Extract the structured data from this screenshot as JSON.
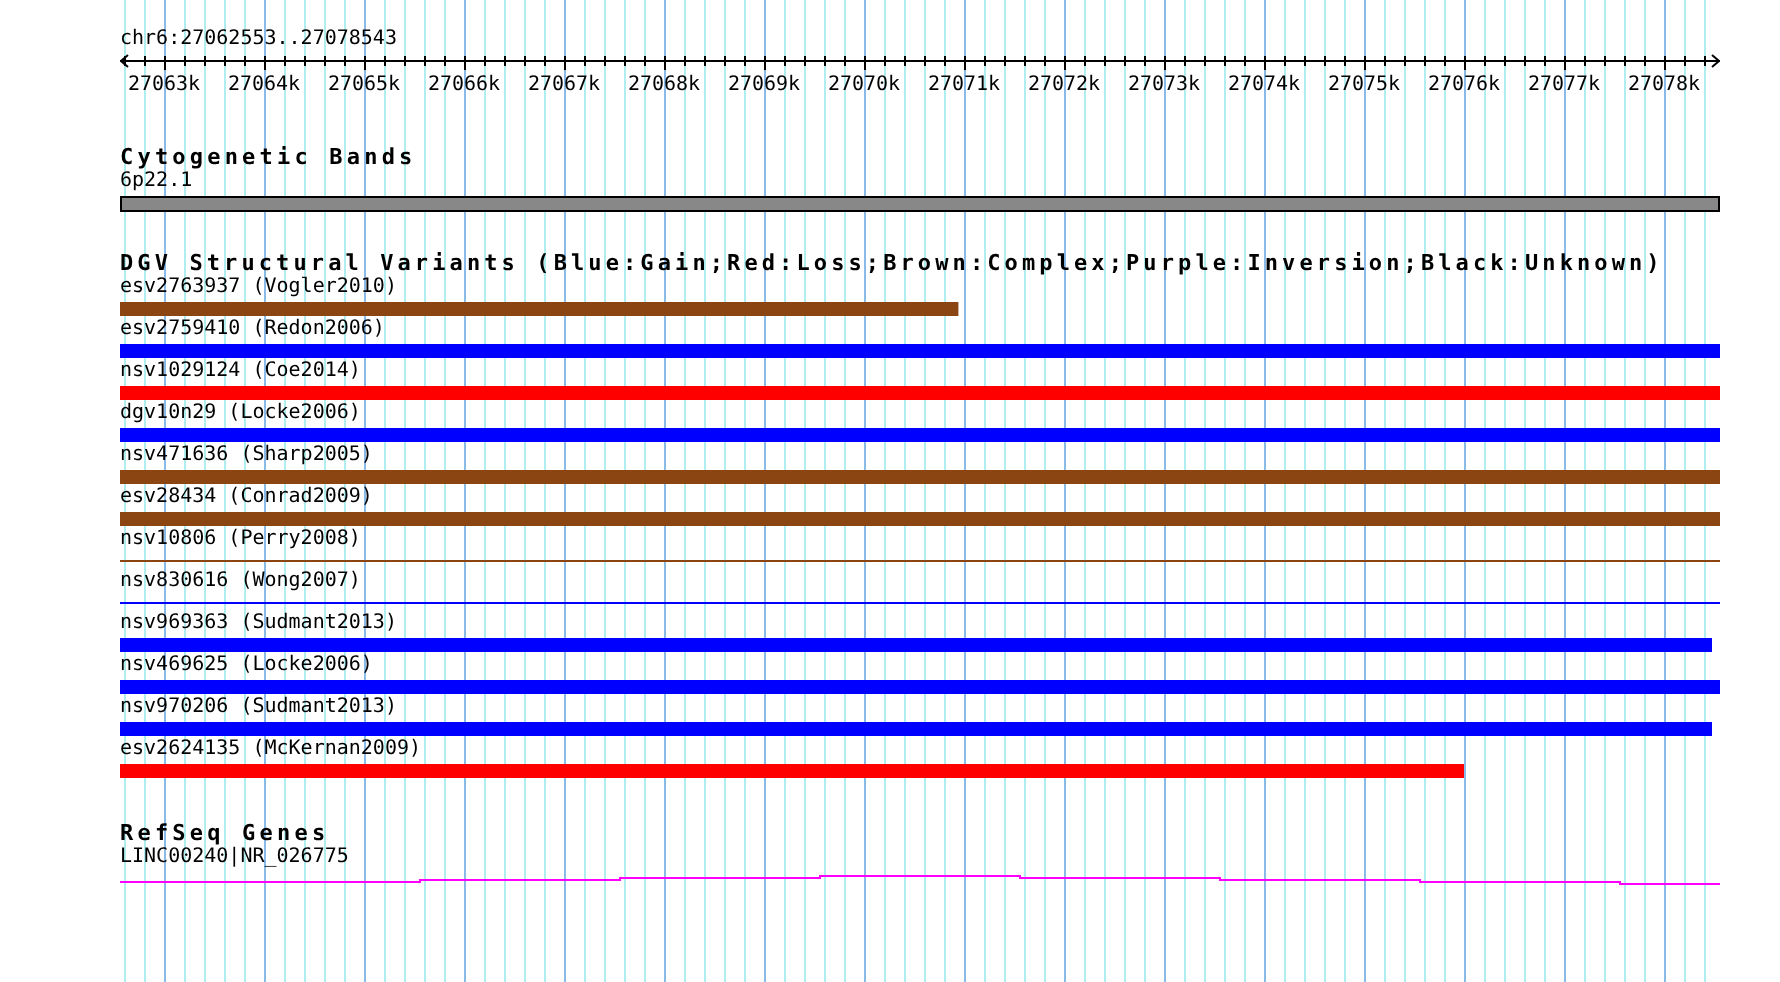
{
  "ruler": {
    "location": "chr6:27062553..27078543",
    "ticks": [
      "27063k",
      "27064k",
      "27065k",
      "27066k",
      "27067k",
      "27068k",
      "27069k",
      "27070k",
      "27071k",
      "27072k",
      "27073k",
      "27074k",
      "27075k",
      "27076k",
      "27077k",
      "27078k"
    ]
  },
  "cytogenetic_bands": {
    "title": "Cytogenetic Bands",
    "band": "6p22.1"
  },
  "dgv": {
    "title": "DGV Structural Variants (Blue:Gain;Red:Loss;Brown:Complex;Purple:Inversion;Black:Unknown)",
    "variants": [
      {
        "label": "esv2763937 (Vogler2010)",
        "color": "#8b4513",
        "kind": "bar",
        "level": 0.524
      },
      {
        "label": "esv2759410 (Redon2006)",
        "color": "#0000ff",
        "kind": "bar",
        "level": 1
      },
      {
        "label": "nsv1029124 (Coe2014)",
        "color": "#ff0000",
        "kind": "bar",
        "level": 1
      },
      {
        "label": "dgv10n29 (Locke2006)",
        "color": "#0000ff",
        "kind": "bar",
        "level": 1
      },
      {
        "label": "nsv471636 (Sharp2005)",
        "color": "#8b4513",
        "kind": "bar",
        "level": 1
      },
      {
        "label": "esv28434 (Conrad2009)",
        "color": "#8b4513",
        "kind": "bar",
        "level": 1
      },
      {
        "label": "nsv10806 (Perry2008)",
        "color": "#8b4513",
        "kind": "line",
        "level": 1
      },
      {
        "label": "nsv830616 (Wong2007)",
        "color": "#0000ff",
        "kind": "line",
        "level": 1
      },
      {
        "label": "nsv969363 (Sudmant2013)",
        "color": "#0000ff",
        "kind": "bar",
        "level": 0.995
      },
      {
        "label": "nsv469625 (Locke2006)",
        "color": "#0000ff",
        "kind": "bar",
        "level": 1
      },
      {
        "label": "nsv970206 (Sudmant2013)",
        "color": "#0000ff",
        "kind": "bar",
        "level": 0.995
      },
      {
        "label": "esv2624135 (McKernan2009)",
        "color": "#ff0000",
        "kind": "bar",
        "level": 0.84
      }
    ]
  },
  "refseq": {
    "title": "RefSeq Genes",
    "gene": "LINC00240|NR_026775"
  }
}
